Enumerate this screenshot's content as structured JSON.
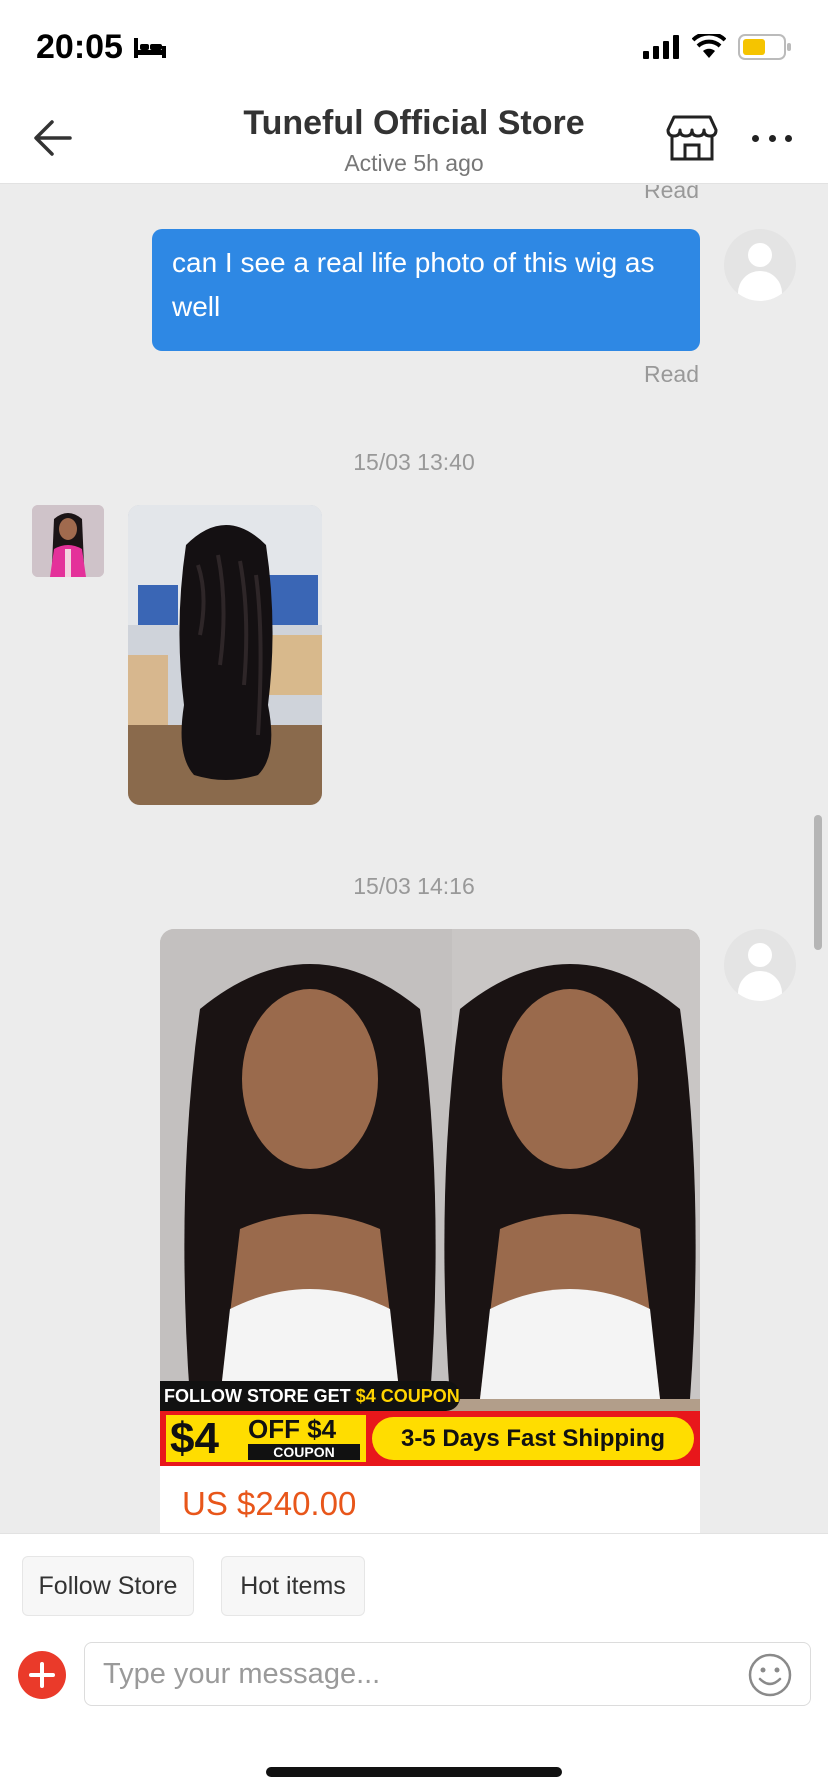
{
  "status_bar": {
    "time": "20:05"
  },
  "header": {
    "title": "Tuneful Official Store",
    "subtitle": "Active 5h ago"
  },
  "chat": {
    "read_label_top": "Read",
    "messages": [
      {
        "type": "text",
        "sender": "user",
        "text": "can I see a real life photo of this wig as well",
        "status": "Read"
      },
      {
        "type": "timestamp",
        "text": "15/03 13:40"
      },
      {
        "type": "image",
        "sender": "store",
        "icon": "wig-photo"
      },
      {
        "type": "timestamp",
        "text": "15/03 14:16"
      },
      {
        "type": "product",
        "sender": "user",
        "promo_line_prefix": "FOLLOW STORE GET",
        "promo_line_highlight": "$4 COUPON",
        "coupon_big": "$4",
        "coupon_off": "OFF $4",
        "coupon_label": "COUPON",
        "shipping": "3-5 Days Fast Shipping",
        "price": "US $240.00"
      }
    ]
  },
  "quick_actions": [
    "Follow Store",
    "Hot items"
  ],
  "composer": {
    "placeholder": "Type your message..."
  },
  "colors": {
    "bubble": "#2e88e4",
    "price": "#e8561a",
    "plus_button": "#ea3a2a",
    "promo_red": "#e8171b",
    "promo_yellow": "#ffdd00"
  }
}
